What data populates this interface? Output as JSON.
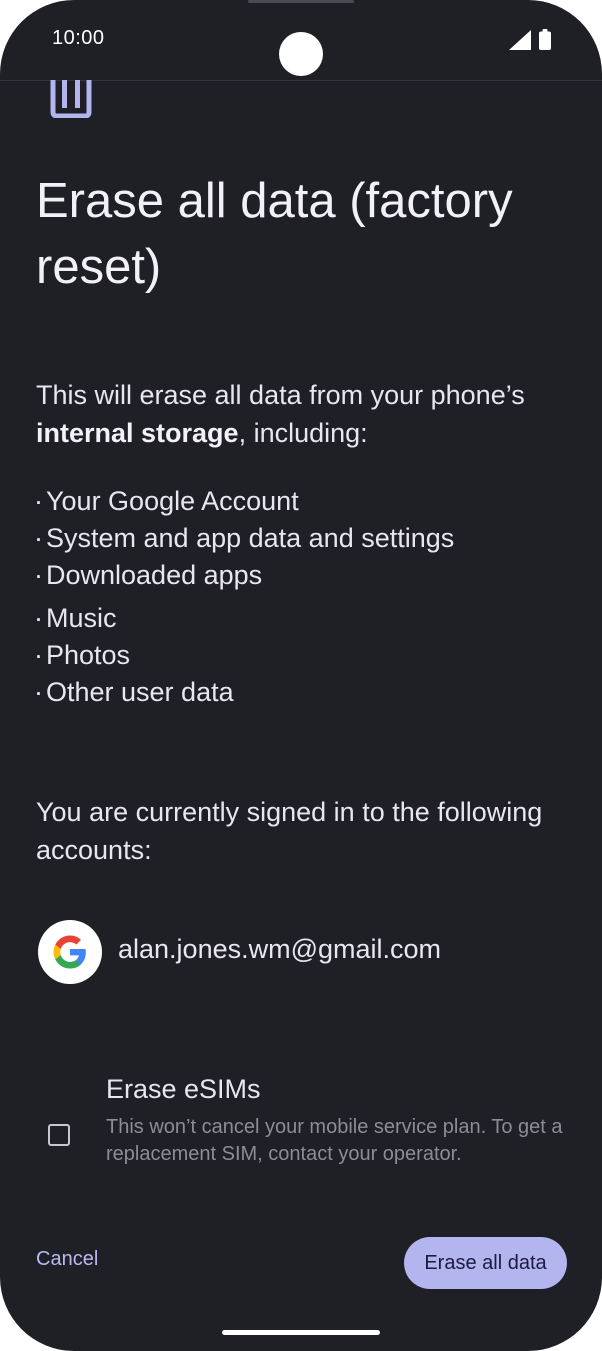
{
  "status_bar": {
    "time": "10:00",
    "signal_icon": "cellular-signal-icon",
    "battery_icon": "battery-full-icon"
  },
  "header": {
    "icon": "factory-reset-icon",
    "title": "Erase all data (factory reset)"
  },
  "intro": {
    "prefix": "This will erase all data from your phone’s ",
    "emphasis": "internal storage",
    "suffix": ", including:"
  },
  "erase_items": [
    "Your Google Account",
    "System and app data and settings",
    "Downloaded apps",
    "Music",
    "Photos",
    "Other user data"
  ],
  "accounts": {
    "label": "You are currently signed in to the following accounts:",
    "items": [
      {
        "icon": "google-logo-icon",
        "email": "alan.jones.wm@gmail.com"
      }
    ]
  },
  "esim": {
    "title": "Erase eSIMs",
    "description": "This won’t cancel your mobile service plan. To get a replacement SIM, contact your operator.",
    "checked": false
  },
  "actions": {
    "cancel_label": "Cancel",
    "erase_label": "Erase all data"
  },
  "colors": {
    "background": "#1f1f26",
    "accent": "#b3b5ee",
    "accent_text": "#b9b9f0"
  }
}
